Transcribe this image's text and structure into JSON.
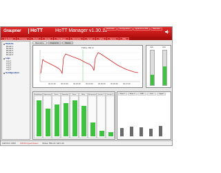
{
  "header": {
    "logo": "Graupner",
    "logo_hott": "HoTT",
    "title": "HoTT Manager v1.30.11",
    "top_buttons": [
      "Verbinden",
      "Konfiguration",
      "Sprache & Hilfe",
      "Beenden"
    ]
  },
  "menubar": [
    "Log-Viewer",
    "Firmware",
    "Modell",
    "Sender",
    "Empfänger",
    "Telemetrie",
    "Sensor",
    "Setup",
    "Service",
    "Hilfe"
  ],
  "sidebar": {
    "groups": [
      {
        "label": "Modelle",
        "items": [
          "Model 1",
          "Model 2",
          "Model 3",
          "Model 4",
          "Model 5"
        ]
      },
      {
        "label": "Logs",
        "items": [
          "Log 1",
          "Log 2",
          "Log 3",
          "Log 4",
          "Log 5"
        ]
      },
      {
        "label": "Konfiguration",
        "items": []
      }
    ]
  },
  "tabs": [
    "Telemetrie",
    "Diagramm",
    "Tabelle"
  ],
  "graph": {
    "title": "Höhe: 80 m",
    "x_ticks": [
      "00:01:00",
      "00:02:00",
      "00:03:00",
      "00:04:00",
      "00:05:00",
      "00:06:00",
      "00:07:00"
    ]
  },
  "gauges": {
    "left_label": "m/s",
    "right_label": "m/s"
  },
  "bottom_columns": [
    "Empfänger",
    "Spannung",
    "Strom",
    "Kapazität",
    "Temp.",
    "Höhe",
    "Variometer",
    "Sensor 1",
    "Sensor 2"
  ],
  "side_columns": [
    "Temp. 1",
    "Temp. 2",
    "RPM",
    "Fuel",
    "Signal"
  ],
  "status": {
    "left": "COM Port: COM3",
    "warn": "COM Port geschlossen",
    "right": "Modus: HW1.20 / SW 1.06"
  },
  "colors": {
    "brand_red": "#c81a1a",
    "graph_line": "#d42020",
    "bar_green": "#3fc23f"
  }
}
